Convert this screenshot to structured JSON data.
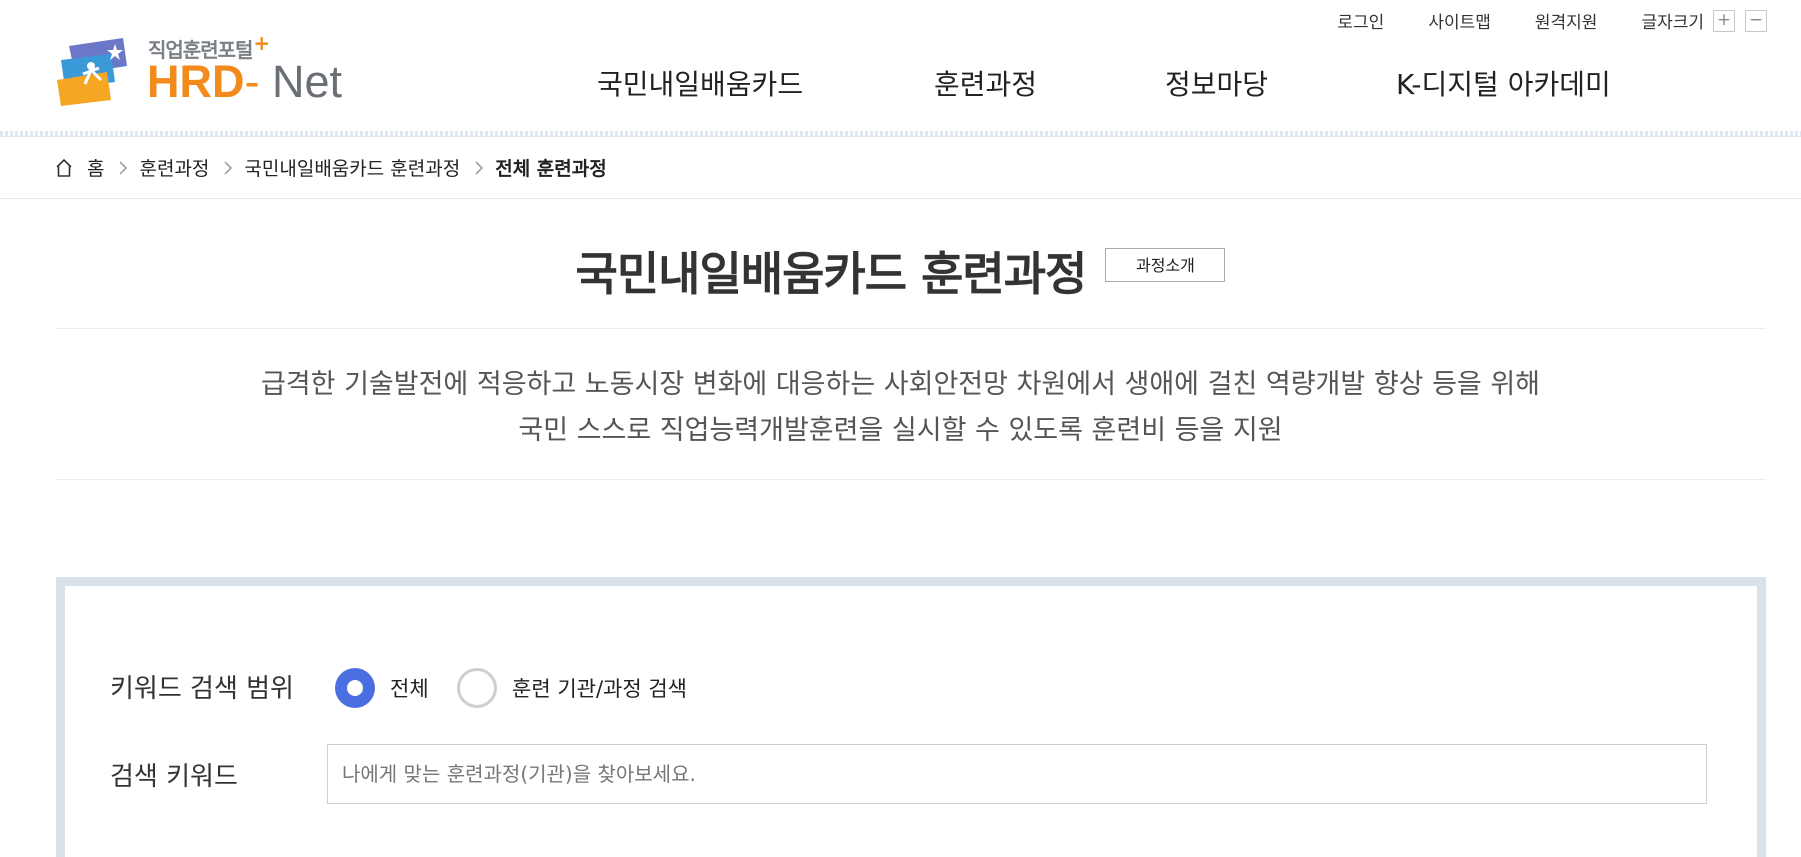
{
  "header": {
    "logo": {
      "subtitle": "직업훈련포털",
      "plus": "+",
      "brand_hrd": "HRD",
      "brand_dash": "-",
      "brand_net": "Net"
    },
    "utility": {
      "login": "로그인",
      "sitemap": "사이트맵",
      "remote": "원격지원",
      "font_size": "글자크기",
      "font_plus": "+",
      "font_minus": "−"
    },
    "nav": [
      "국민내일배움카드",
      "훈련과정",
      "정보마당",
      "K-디지털 아카데미"
    ]
  },
  "breadcrumb": {
    "home": "홈",
    "items": [
      "훈련과정",
      "국민내일배움카드 훈련과정"
    ],
    "current": "전체 훈련과정"
  },
  "page": {
    "title": "국민내일배움카드 훈련과정",
    "intro_button": "과정소개",
    "description_line1": "급격한 기술발전에 적응하고 노동시장 변화에 대응하는 사회안전망 차원에서 생애에 걸친 역량개발 향상 등을 위해",
    "description_line2": "국민 스스로 직업능력개발훈련을 실시할 수 있도록 훈련비 등을 지원"
  },
  "search": {
    "scope_label": "키워드 검색 범위",
    "scope_options": [
      "전체",
      "훈련 기관/과정 검색"
    ],
    "scope_selected": "전체",
    "keyword_label": "검색 키워드",
    "keyword_value": "",
    "keyword_placeholder": "나에게 맞는 훈련과정(기관)을 찾아보세요."
  },
  "colors": {
    "accent_orange": "#f28a1c",
    "radio_blue": "#4a6fe0",
    "box_border": "#d9e1ea"
  }
}
